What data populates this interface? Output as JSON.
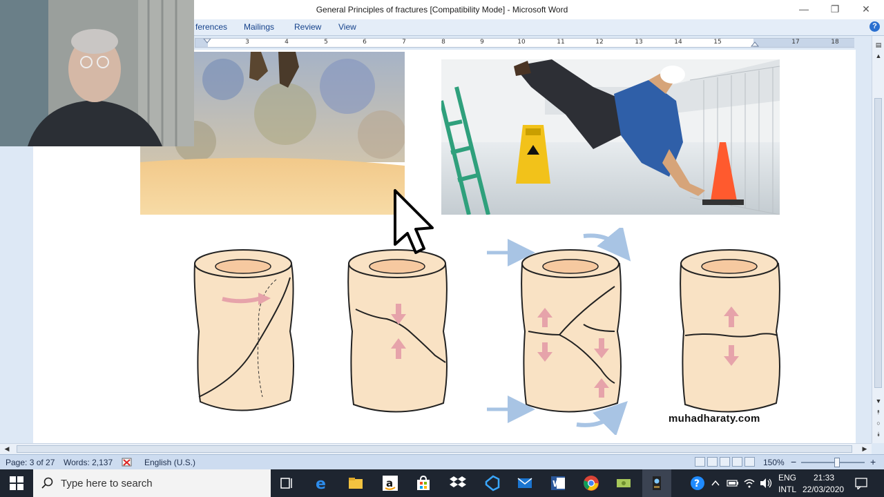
{
  "window": {
    "title": "General Principles of fractures [Compatibility Mode] - Microsoft Word",
    "minimize": "—",
    "restore": "❐",
    "close": "✕"
  },
  "ribbon": {
    "tabs": [
      "ferences",
      "Mailings",
      "Review",
      "View"
    ],
    "help": "?"
  },
  "ruler": {
    "labels": [
      "3",
      "4",
      "5",
      "6",
      "7",
      "8",
      "9",
      "10",
      "11",
      "12",
      "13",
      "14",
      "15",
      "",
      "17",
      "18"
    ]
  },
  "document": {
    "watermark": "muhadharaty.com"
  },
  "statusbar": {
    "page": "Page: 3 of 27",
    "words": "Words: 2,137",
    "language": "English (U.S.)",
    "zoom": "150%",
    "zoom_minus": "−",
    "zoom_plus": "+"
  },
  "taskbar": {
    "search_placeholder": "Type here to search",
    "apps": [
      "task-view-icon",
      "edge-icon",
      "file-explorer-icon",
      "amazon-icon",
      "store-icon",
      "dropbox-icon",
      "visual-studio-icon",
      "mail-icon",
      "word-icon",
      "chrome-icon",
      "money-icon",
      "camera-app-icon"
    ],
    "tray": {
      "language_top": "ENG",
      "language_bottom": "INTL",
      "time": "21:33",
      "date": "22/03/2020"
    }
  },
  "colors": {
    "word_blue": "#2b579a",
    "ribbon_bg": "#e4edf8",
    "taskbar_bg": "#1e2530",
    "bone_fill": "#f9e2c4",
    "arrow_pink": "#e6a3aa",
    "arrow_blue": "#a8c4e4"
  }
}
